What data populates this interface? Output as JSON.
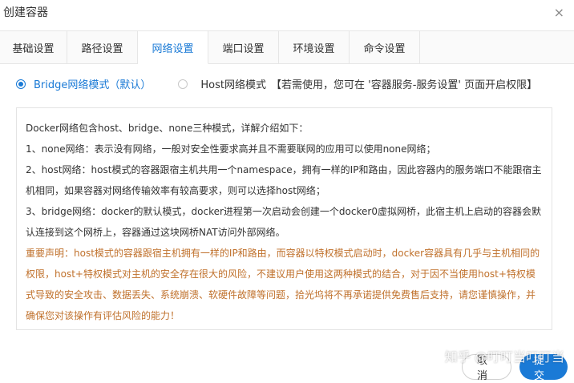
{
  "dialog": {
    "title": "创建容器",
    "close_icon": "×"
  },
  "tabs": [
    {
      "label": "基础设置",
      "active": false
    },
    {
      "label": "路径设置",
      "active": false
    },
    {
      "label": "网络设置",
      "active": true
    },
    {
      "label": "端口设置",
      "active": false
    },
    {
      "label": "环境设置",
      "active": false
    },
    {
      "label": "命令设置",
      "active": false
    }
  ],
  "network_mode": {
    "bridge_label": "Bridge网络模式（默认）",
    "host_label": "Host网络模式",
    "host_note": "【若需使用，您可在 '容器服务-服务设置' 页面开启权限】"
  },
  "info": {
    "intro": "Docker网络包含host、bridge、none三种模式，详解介绍如下：",
    "none": "1、none网络：表示没有网络，一般对安全性要求高并且不需要联网的应用可以使用none网络；",
    "host": "2、host网络：host模式的容器跟宿主机共用一个namespace，拥有一样的IP和路由，因此容器内的服务端口不能跟宿主机相同，如果容器对网络传输效率有较高要求，则可以选择host网络；",
    "bridge": "3、bridge网络：docker的默认模式，docker进程第一次启动会创建一个docker0虚拟网桥，此宿主机上启动的容器会默认连接到这个网桥上，容器通过这块网桥NAT访问外部网络。",
    "warning": "重要声明：host模式的容器跟宿主机拥有一样的IP和路由，而容器以特权模式启动时，docker容器具有几乎与主机相同的权限，host+特权模式对主机的安全存在很大的风险，不建议用户使用这两种模式的结合，对于因不当使用host+特权模式导致的安全攻击、数据丢失、系统崩溃、软硬件故障等问题，拾光坞将不再承诺提供免费售后支持，请您谨慎操作，并确保您对该操作有评估风险的能力！"
  },
  "footer": {
    "cancel_label": "取消",
    "submit_label": "提交"
  },
  "watermark": "知乎 @叮叮当叮叮当",
  "colors": {
    "accent": "#1a7ad6",
    "warning": "#c0712c"
  }
}
